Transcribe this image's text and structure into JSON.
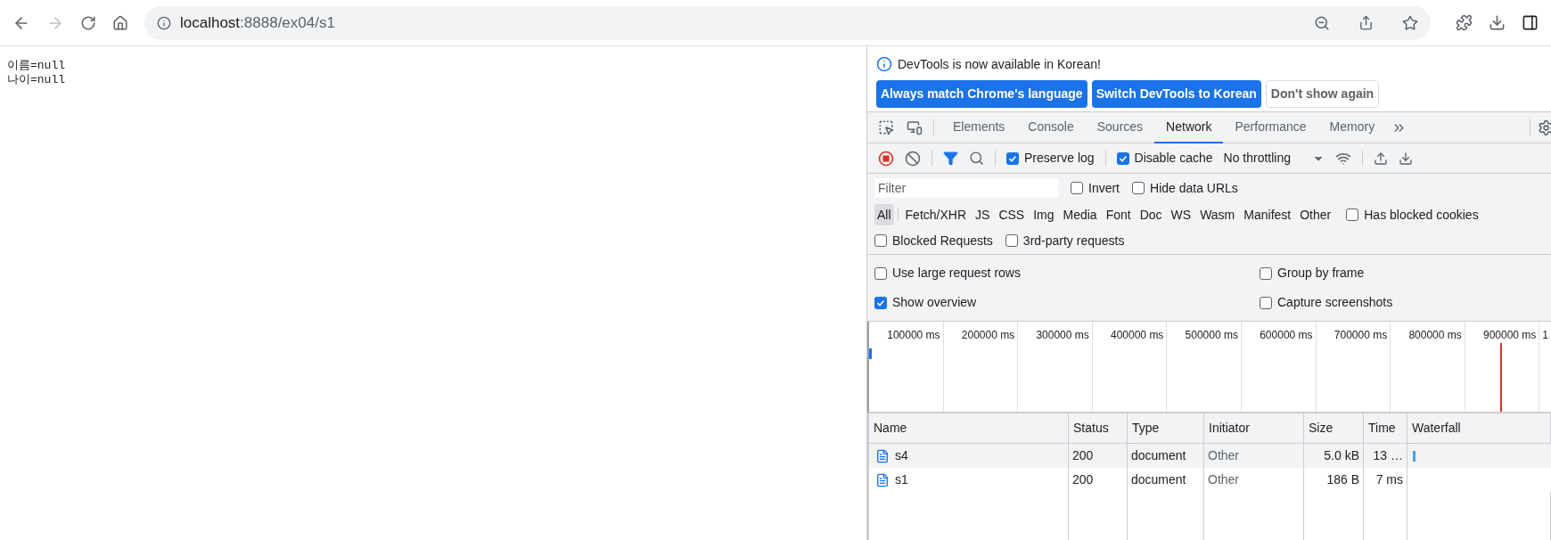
{
  "address_bar": {
    "host": "localhost",
    "rest": ":8888/ex04/s1"
  },
  "page": {
    "lines": [
      "이름=null",
      "나이=null"
    ]
  },
  "devtools": {
    "banner": {
      "message": "DevTools is now available in Korean!",
      "buttons": [
        {
          "label": "Always match Chrome's language",
          "kind": "primary"
        },
        {
          "label": "Switch DevTools to Korean",
          "kind": "primary"
        },
        {
          "label": "Don't show again",
          "kind": "secondary"
        }
      ]
    },
    "tabs": [
      {
        "label": "Elements",
        "selected": false
      },
      {
        "label": "Console",
        "selected": false
      },
      {
        "label": "Sources",
        "selected": false
      },
      {
        "label": "Network",
        "selected": true
      },
      {
        "label": "Performance",
        "selected": false
      },
      {
        "label": "Memory",
        "selected": false
      }
    ],
    "toolbar": {
      "preserve_log": {
        "label": "Preserve log",
        "checked": true
      },
      "disable_cache": {
        "label": "Disable cache",
        "checked": true
      },
      "throttling": "No throttling"
    },
    "filter": {
      "placeholder": "Filter",
      "options": [
        {
          "label": "Invert",
          "checked": false
        },
        {
          "label": "Hide data URLs",
          "checked": false
        }
      ]
    },
    "types": [
      {
        "label": "All",
        "selected": true
      },
      {
        "label": "Fetch/XHR",
        "selected": false
      },
      {
        "label": "JS",
        "selected": false
      },
      {
        "label": "CSS",
        "selected": false
      },
      {
        "label": "Img",
        "selected": false
      },
      {
        "label": "Media",
        "selected": false
      },
      {
        "label": "Font",
        "selected": false
      },
      {
        "label": "Doc",
        "selected": false
      },
      {
        "label": "WS",
        "selected": false
      },
      {
        "label": "Wasm",
        "selected": false
      },
      {
        "label": "Manifest",
        "selected": false
      },
      {
        "label": "Other",
        "selected": false
      }
    ],
    "has_blocked_cookies": {
      "label": "Has blocked cookies",
      "checked": false
    },
    "request_options": [
      {
        "label": "Blocked Requests",
        "checked": false
      },
      {
        "label": "3rd-party requests",
        "checked": false
      }
    ],
    "settings": [
      {
        "label": "Use large request rows",
        "checked": false
      },
      {
        "label": "Group by frame",
        "checked": false
      },
      {
        "label": "Show overview",
        "checked": true
      },
      {
        "label": "Capture screenshots",
        "checked": false
      }
    ],
    "overview": {
      "ticks": [
        "100000 ms",
        "200000 ms",
        "300000 ms",
        "400000 ms",
        "500000 ms",
        "600000 ms",
        "700000 ms",
        "800000 ms",
        "900000 ms",
        "1"
      ]
    },
    "table": {
      "columns": [
        "Name",
        "Status",
        "Type",
        "Initiator",
        "Size",
        "Time",
        "Waterfall"
      ],
      "rows": [
        {
          "name": "s4",
          "status": "200",
          "type": "document",
          "initiator": "Other",
          "size": "5.0 kB",
          "time": "13 …",
          "selected": true,
          "waterfall_bar": true
        },
        {
          "name": "s1",
          "status": "200",
          "type": "document",
          "initiator": "Other",
          "size": "186 B",
          "time": "7 ms",
          "selected": false,
          "waterfall_bar": false
        }
      ]
    }
  }
}
